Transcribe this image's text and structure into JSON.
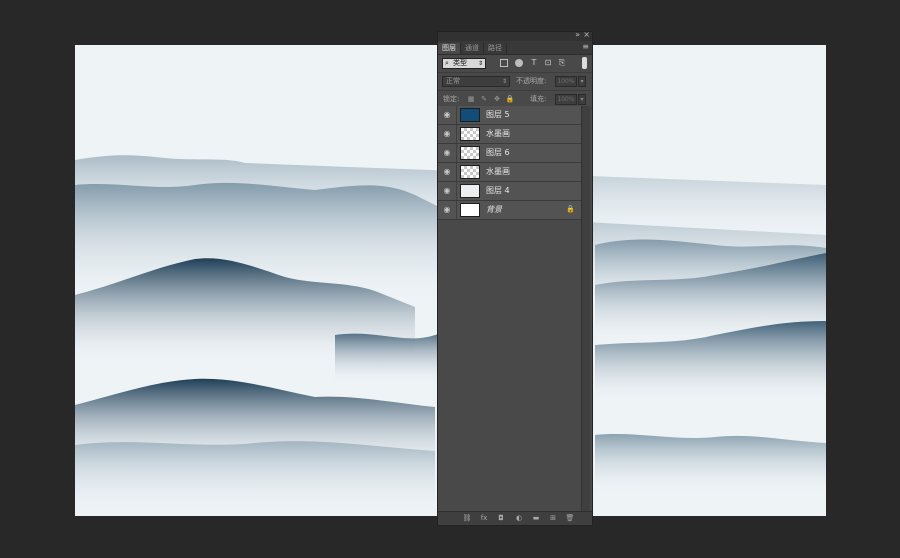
{
  "panel": {
    "collapse_glyph": "»",
    "close_glyph": "×",
    "menu_glyph": "≡",
    "tabs": [
      {
        "label": "图层"
      },
      {
        "label": "通道"
      },
      {
        "label": "路径"
      }
    ],
    "filter": {
      "kind_label": "类型",
      "search_glyph": "⌕",
      "chevron": "⇕",
      "icons": [
        "image-filter-icon",
        "adjustment-filter-icon",
        "type-filter-icon",
        "shape-filter-icon",
        "smart-object-filter-icon"
      ],
      "type_glyph": "T",
      "shape_glyph": "⊡",
      "smart_glyph": "⎘"
    },
    "blend": {
      "mode": "正常",
      "chevron": "⇕",
      "opacity_label": "不透明度:",
      "opacity_value": "100%",
      "arrow": "▾"
    },
    "lock_row": {
      "lock_label": "锁定:",
      "fill_label": "填充:",
      "fill_value": "100%",
      "arrow": "▾",
      "icons": [
        "▦",
        "✎",
        "✥",
        "🔒"
      ]
    },
    "layers": [
      {
        "name": "图层 5",
        "thumb": "blue",
        "eye": "◉"
      },
      {
        "name": "水墨画",
        "thumb": "trans",
        "eye": "◉"
      },
      {
        "name": "图层 6",
        "thumb": "trans",
        "eye": "◉"
      },
      {
        "name": "水墨画",
        "thumb": "trans",
        "eye": "◉"
      },
      {
        "name": "图层 4",
        "thumb": "light",
        "eye": "◉"
      },
      {
        "name": "背景",
        "thumb": "white",
        "eye": "◉",
        "locked": true,
        "lock_glyph": "🔒"
      }
    ],
    "bottom_icons": [
      {
        "name": "link-layers-icon",
        "glyph": "⛓"
      },
      {
        "name": "fx-icon",
        "glyph": "fx"
      },
      {
        "name": "mask-icon",
        "glyph": "◘"
      },
      {
        "name": "adjustment-layer-icon",
        "glyph": "◐"
      },
      {
        "name": "group-folder-icon",
        "glyph": "▬"
      },
      {
        "name": "new-layer-icon",
        "glyph": "⊞"
      },
      {
        "name": "trash-icon",
        "glyph": "🗑"
      }
    ]
  },
  "colors": {
    "workspace": "#282828",
    "canvas_bg": "#eef3f6",
    "panel_bg": "#494949",
    "layer_row": "#535353",
    "layer5_thumb": "#124d7a",
    "mountain_dark": "#1f3f58"
  }
}
